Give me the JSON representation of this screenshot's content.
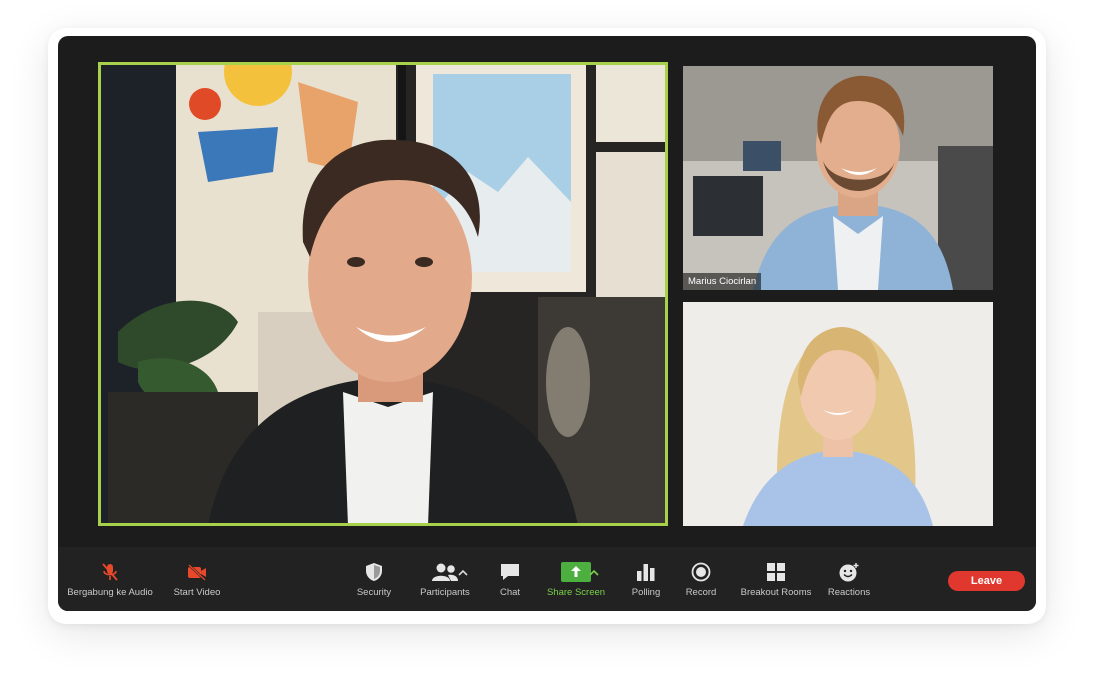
{
  "participants": {
    "main": {
      "name": ""
    },
    "top_right": {
      "name": "Marius Ciocirlan"
    },
    "bottom_right": {
      "name": ""
    }
  },
  "toolbar": {
    "audio_label": "Bergabung ke Audio",
    "video_label": "Start Video",
    "security_label": "Security",
    "participants_label": "Participants",
    "chat_label": "Chat",
    "share_label": "Share Screen",
    "polling_label": "Polling",
    "record_label": "Record",
    "breakout_label": "Breakout Rooms",
    "reactions_label": "Reactions",
    "leave_label": "Leave"
  },
  "colors": {
    "window_bg": "#1c1c1c",
    "toolbar_bg": "#222222",
    "active_speaker_border": "#a7d14b",
    "share_green": "#4caf3f",
    "muted_red": "#e8492b",
    "leave_red": "#e0382e"
  },
  "icons": {
    "audio": "microphone-muted-icon",
    "video": "camera-off-icon",
    "security": "shield-icon",
    "participants": "people-icon",
    "chat": "chat-bubble-icon",
    "share": "share-arrow-icon",
    "polling": "bar-chart-icon",
    "record": "record-icon",
    "breakout": "grid-icon",
    "reactions": "smiley-icon"
  }
}
